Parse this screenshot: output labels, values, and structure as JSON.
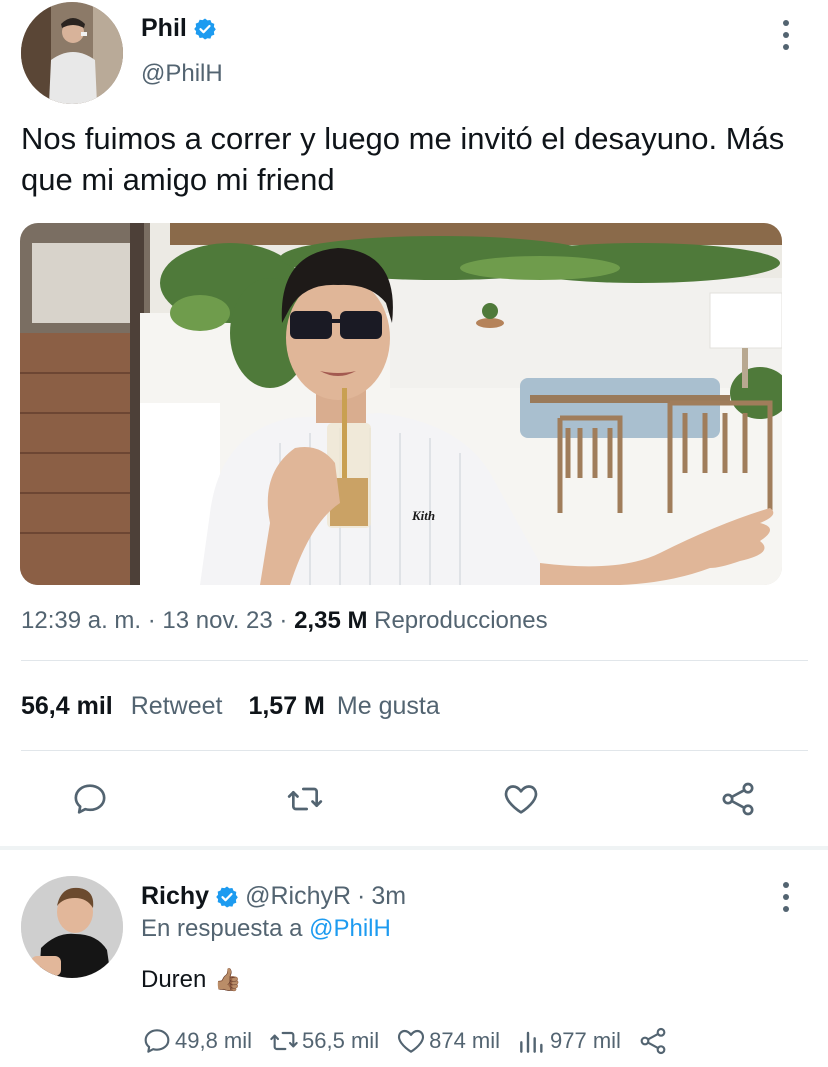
{
  "main_tweet": {
    "author_name": "Phil",
    "author_handle": "@PhilH",
    "text": "Nos fuimos a correr y luego me invitó el desayuno. Más que mi amigo mi friend",
    "time": "12:39 a. m.",
    "date": "13 nov. 23",
    "views_count": "2,35 M",
    "views_label": "Reproducciones",
    "retweets_count": "56,4 mil",
    "retweets_label": "Retweet",
    "likes_count": "1,57 M",
    "likes_label": "Me gusta",
    "shirt_logo": "Kith"
  },
  "actions": {
    "reply_icon": "speech-bubble-icon",
    "retweet_icon": "retweet-arrows-icon",
    "like_icon": "heart-icon",
    "share_icon": "share-nodes-icon"
  },
  "reply": {
    "author_name": "Richy",
    "author_handle": "@RichyR",
    "separator": "·",
    "time": "3m",
    "reply_prefix": "En respuesta a",
    "reply_mention": "@PhilH",
    "text": "Duren",
    "emoji": "👍🏽",
    "replies": "49,8 mil",
    "retweets": "56,5 mil",
    "likes": "874 mil",
    "views": "977 mil"
  },
  "colors": {
    "verified": "#1d9bf0",
    "mention": "#1d9bf0",
    "secondary_text": "#536471",
    "primary_text": "#0f1419"
  }
}
